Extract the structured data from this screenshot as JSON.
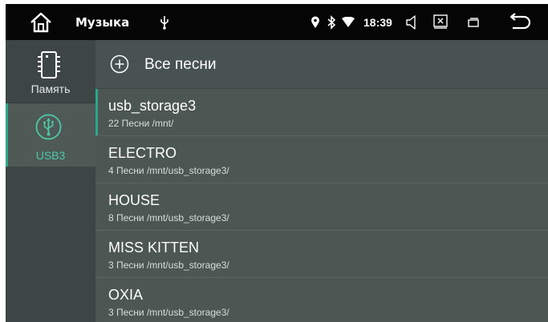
{
  "status_bar": {
    "title": "Музыка",
    "time": "18:39",
    "icons": [
      "home-icon",
      "usb-icon",
      "location-icon",
      "bluetooth-icon",
      "wifi-icon",
      "volume-icon",
      "close-window-icon",
      "window-icon",
      "back-icon"
    ]
  },
  "sidebar": {
    "items": [
      {
        "label": "Память",
        "icon": "memory-chip-icon",
        "selected": false
      },
      {
        "label": "USB3",
        "icon": "usb-icon",
        "selected": true
      }
    ]
  },
  "content": {
    "all_songs": {
      "label": "Все песни",
      "icon": "add-circle-icon"
    },
    "folders": [
      {
        "name": "usb_storage3",
        "info": "22 Песни /mnt/"
      },
      {
        "name": "ELECTRO",
        "info": "4 Песни /mnt/usb_storage3/"
      },
      {
        "name": "HOUSE",
        "info": "8 Песни /mnt/usb_storage3/"
      },
      {
        "name": "MISS KITTEN",
        "info": "3 Песни /mnt/usb_storage3/"
      },
      {
        "name": "OXIA",
        "info": "3 Песни /mnt/usb_storage3/"
      }
    ]
  },
  "colors": {
    "accent": "#2aa889",
    "statusbar": "#050505",
    "background": "#4c5653"
  }
}
